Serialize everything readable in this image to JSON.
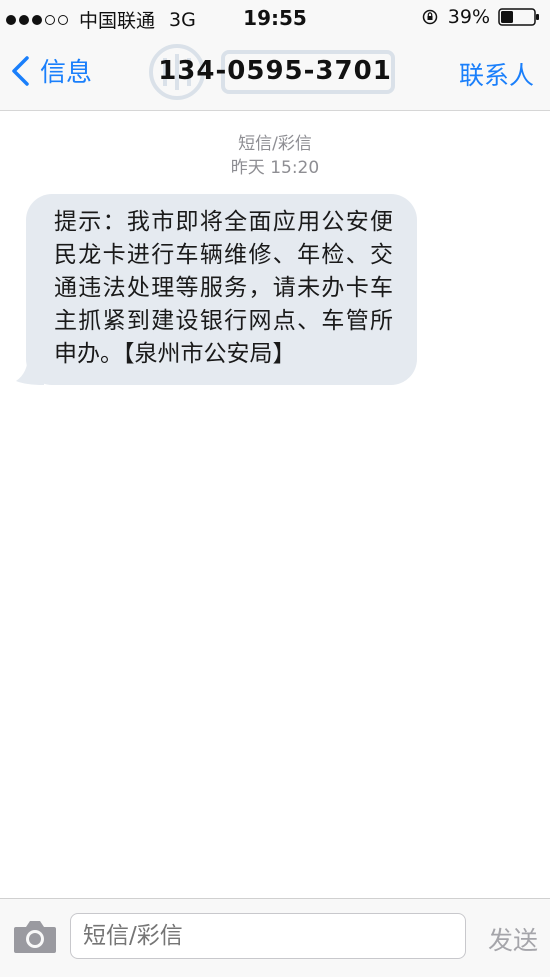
{
  "status_bar": {
    "carrier": "中国联通",
    "network": "3G",
    "time": "19:55",
    "battery": "39%",
    "signal_strength": 3,
    "signal_total": 5
  },
  "nav": {
    "back_label": "信息",
    "title": "134-0595-3701",
    "contact_label": "联系人"
  },
  "thread": {
    "message_type": "短信/彩信",
    "timestamp": "昨天 15:20",
    "messages": [
      {
        "direction": "incoming",
        "text": "提示：我市即将全面应用公安便民龙卡进行车辆维修、年检、交通违法处理等服务，请未办卡车主抓紧到建设银行网点、车管所申办。【泉州市公安局】"
      }
    ]
  },
  "input_bar": {
    "placeholder": "短信/彩信",
    "send_label": "发送"
  },
  "colors": {
    "accent": "#1a7ffb",
    "bubble": "#e5eaf0",
    "meta_text": "#8e8e93"
  }
}
